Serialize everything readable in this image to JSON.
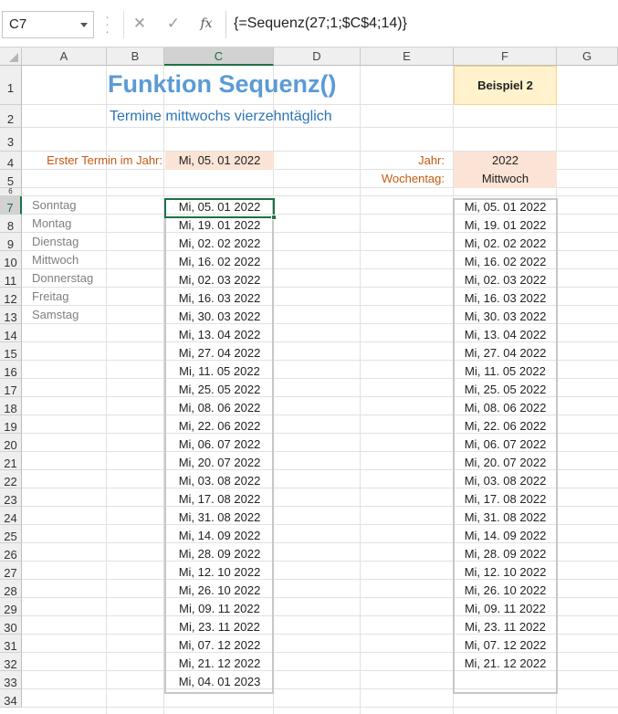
{
  "formula_bar": {
    "name_box": "C7",
    "cancel_icon": "✕",
    "enter_icon": "✓",
    "fx_label": "fx",
    "formula": "{=Sequenz(27;1;$C$4;14)}"
  },
  "columns": [
    "A",
    "B",
    "C",
    "D",
    "E",
    "F",
    "G"
  ],
  "selected_column": "C",
  "selected_row": "7",
  "rows": [
    "1",
    "2",
    "3",
    "4",
    "5",
    "6",
    "7",
    "8",
    "9",
    "10",
    "11",
    "12",
    "13",
    "14",
    "15",
    "16",
    "17",
    "18",
    "19",
    "20",
    "21",
    "22",
    "23",
    "24",
    "25",
    "26",
    "27",
    "28",
    "29",
    "30",
    "31",
    "32",
    "33",
    "34"
  ],
  "sheet": {
    "title": "Funktion Sequenz()",
    "subtitle": "Termine mittwochs vierzehntäglich",
    "example_label": "Beispiel 2",
    "first_date_label": "Erster Termin im Jahr:",
    "first_date_value": "Mi, 05. 01 2022",
    "year_label": "Jahr:",
    "year_value": "2022",
    "weekday_label": "Wochentag:",
    "weekday_value": "Mittwoch",
    "weekdays": [
      "Sonntag",
      "Montag",
      "Dienstag",
      "Mittwoch",
      "Donnerstag",
      "Freitag",
      "Samstag"
    ],
    "dates_c": [
      "Mi, 05. 01 2022",
      "Mi, 19. 01 2022",
      "Mi, 02. 02 2022",
      "Mi, 16. 02 2022",
      "Mi, 02. 03 2022",
      "Mi, 16. 03 2022",
      "Mi, 30. 03 2022",
      "Mi, 13. 04 2022",
      "Mi, 27. 04 2022",
      "Mi, 11. 05 2022",
      "Mi, 25. 05 2022",
      "Mi, 08. 06 2022",
      "Mi, 22. 06 2022",
      "Mi, 06. 07 2022",
      "Mi, 20. 07 2022",
      "Mi, 03. 08 2022",
      "Mi, 17. 08 2022",
      "Mi, 31. 08 2022",
      "Mi, 14. 09 2022",
      "Mi, 28. 09 2022",
      "Mi, 12. 10 2022",
      "Mi, 26. 10 2022",
      "Mi, 09. 11 2022",
      "Mi, 23. 11 2022",
      "Mi, 07. 12 2022",
      "Mi, 21. 12 2022",
      "Mi, 04. 01 2023"
    ],
    "dates_f": [
      "Mi, 05. 01 2022",
      "Mi, 19. 01 2022",
      "Mi, 02. 02 2022",
      "Mi, 16. 02 2022",
      "Mi, 02. 03 2022",
      "Mi, 16. 03 2022",
      "Mi, 30. 03 2022",
      "Mi, 13. 04 2022",
      "Mi, 27. 04 2022",
      "Mi, 11. 05 2022",
      "Mi, 25. 05 2022",
      "Mi, 08. 06 2022",
      "Mi, 22. 06 2022",
      "Mi, 06. 07 2022",
      "Mi, 20. 07 2022",
      "Mi, 03. 08 2022",
      "Mi, 17. 08 2022",
      "Mi, 31. 08 2022",
      "Mi, 14. 09 2022",
      "Mi, 28. 09 2022",
      "Mi, 12. 10 2022",
      "Mi, 26. 10 2022",
      "Mi, 09. 11 2022",
      "Mi, 23. 11 2022",
      "Mi, 07. 12 2022",
      "Mi, 21. 12 2022"
    ]
  }
}
